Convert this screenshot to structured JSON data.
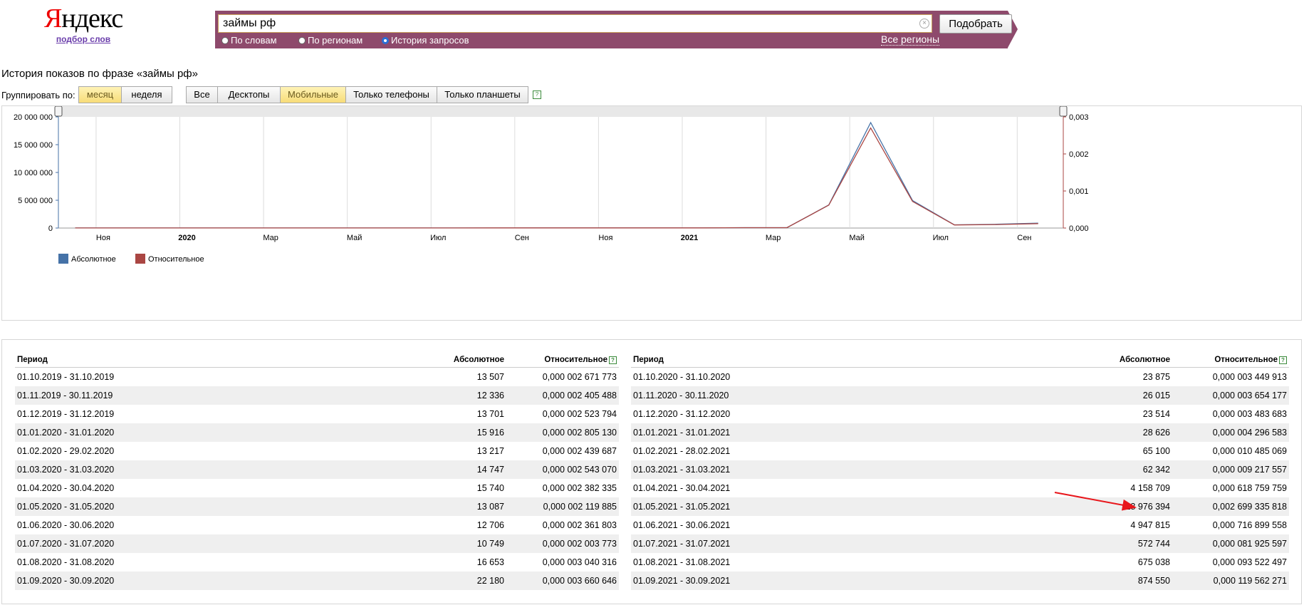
{
  "header": {
    "logo_text": "Яндекс",
    "logo_sub": "подбор слов",
    "query": "займы рф",
    "submit_label": "Подобрать",
    "radios": [
      {
        "label": "По словам",
        "checked": false
      },
      {
        "label": "По регионам",
        "checked": false
      },
      {
        "label": "История запросов",
        "checked": true
      }
    ],
    "regions_link": "Все регионы"
  },
  "page_title": "История показов по фразе «займы рф»",
  "toolbar": {
    "group_label": "Группировать по:",
    "group_buttons": [
      {
        "label": "месяц",
        "active": true
      },
      {
        "label": "неделя",
        "active": false
      }
    ],
    "device_buttons": [
      {
        "label": "Все",
        "active": false
      },
      {
        "label": "Десктопы",
        "active": false
      },
      {
        "label": "Мобильные",
        "active": true
      },
      {
        "label": "Только телефоны",
        "active": false
      },
      {
        "label": "Только планшеты",
        "active": false
      }
    ],
    "help_icon": "question-icon"
  },
  "chart_data": {
    "type": "line",
    "x": [
      "2019-10",
      "2019-11",
      "2019-12",
      "2020-01",
      "2020-02",
      "2020-03",
      "2020-04",
      "2020-05",
      "2020-06",
      "2020-07",
      "2020-08",
      "2020-09",
      "2020-10",
      "2020-11",
      "2020-12",
      "2021-01",
      "2021-02",
      "2021-03",
      "2021-04",
      "2021-05",
      "2021-06",
      "2021-07",
      "2021-08",
      "2021-09"
    ],
    "x_tick_labels": [
      "Ноя",
      "2020",
      "Мар",
      "Май",
      "Июл",
      "Сен",
      "Ноя",
      "2021",
      "Мар",
      "Май",
      "Июл",
      "Сен"
    ],
    "y_left_ticks": [
      "20 000 000",
      "15 000 000",
      "10 000 000",
      "5 000 000",
      "0"
    ],
    "y_right_ticks": [
      "0,003",
      "0,002",
      "0,001",
      "0,000"
    ],
    "ylim_left": [
      0,
      20000000
    ],
    "ylim_right": [
      0,
      0.003
    ],
    "series": [
      {
        "name": "Абсолютное",
        "axis": "left",
        "color": "#4572a7",
        "values": [
          13507,
          12336,
          13701,
          15916,
          13217,
          14747,
          15740,
          13087,
          12706,
          10749,
          16653,
          22180,
          23875,
          26015,
          23514,
          28626,
          65100,
          62342,
          4158709,
          18976394,
          4947815,
          572744,
          675038,
          874550
        ]
      },
      {
        "name": "Относительное",
        "axis": "right",
        "color": "#aa4643",
        "values": [
          2.671773e-06,
          2.405488e-06,
          2.523794e-06,
          2.80513e-06,
          2.439687e-06,
          2.54307e-06,
          2.382335e-06,
          2.119885e-06,
          2.361803e-06,
          2.003773e-06,
          3.040316e-06,
          3.660646e-06,
          3.449913e-06,
          3.654177e-06,
          3.483683e-06,
          4.296583e-06,
          1.0485069e-05,
          9.217557e-06,
          0.000618759759,
          0.002699335818,
          0.000716899558,
          8.1925597e-05,
          9.3522497e-05,
          0.000119562271
        ]
      }
    ],
    "legend_position": "bottom-left",
    "grid": true
  },
  "table": {
    "headers": {
      "period": "Период",
      "absolute": "Абсолютное",
      "relative": "Относительное"
    },
    "left_rows": [
      [
        "01.10.2019 - 31.10.2019",
        "13 507",
        "0,000 002 671 773"
      ],
      [
        "01.11.2019 - 30.11.2019",
        "12 336",
        "0,000 002 405 488"
      ],
      [
        "01.12.2019 - 31.12.2019",
        "13 701",
        "0,000 002 523 794"
      ],
      [
        "01.01.2020 - 31.01.2020",
        "15 916",
        "0,000 002 805 130"
      ],
      [
        "01.02.2020 - 29.02.2020",
        "13 217",
        "0,000 002 439 687"
      ],
      [
        "01.03.2020 - 31.03.2020",
        "14 747",
        "0,000 002 543 070"
      ],
      [
        "01.04.2020 - 30.04.2020",
        "15 740",
        "0,000 002 382 335"
      ],
      [
        "01.05.2020 - 31.05.2020",
        "13 087",
        "0,000 002 119 885"
      ],
      [
        "01.06.2020 - 30.06.2020",
        "12 706",
        "0,000 002 361 803"
      ],
      [
        "01.07.2020 - 31.07.2020",
        "10 749",
        "0,000 002 003 773"
      ],
      [
        "01.08.2020 - 31.08.2020",
        "16 653",
        "0,000 003 040 316"
      ],
      [
        "01.09.2020 - 30.09.2020",
        "22 180",
        "0,000 003 660 646"
      ]
    ],
    "right_rows": [
      [
        "01.10.2020 - 31.10.2020",
        "23 875",
        "0,000 003 449 913"
      ],
      [
        "01.11.2020 - 30.11.2020",
        "26 015",
        "0,000 003 654 177"
      ],
      [
        "01.12.2020 - 31.12.2020",
        "23 514",
        "0,000 003 483 683"
      ],
      [
        "01.01.2021 - 31.01.2021",
        "28 626",
        "0,000 004 296 583"
      ],
      [
        "01.02.2021 - 28.02.2021",
        "65 100",
        "0,000 010 485 069"
      ],
      [
        "01.03.2021 - 31.03.2021",
        "62 342",
        "0,000 009 217 557"
      ],
      [
        "01.04.2021 - 30.04.2021",
        "4 158 709",
        "0,000 618 759 759"
      ],
      [
        "01.05.2021 - 31.05.2021",
        "18 976 394",
        "0,002 699 335 818"
      ],
      [
        "01.06.2021 - 30.06.2021",
        "4 947 815",
        "0,000 716 899 558"
      ],
      [
        "01.07.2021 - 31.07.2021",
        "572 744",
        "0,000 081 925 597"
      ],
      [
        "01.08.2021 - 31.08.2021",
        "675 038",
        "0,000 093 522 497"
      ],
      [
        "01.09.2021 - 30.09.2021",
        "874 550",
        "0,000 119 562 271"
      ]
    ]
  },
  "annotation": {
    "arrow_color": "#e8161b"
  }
}
